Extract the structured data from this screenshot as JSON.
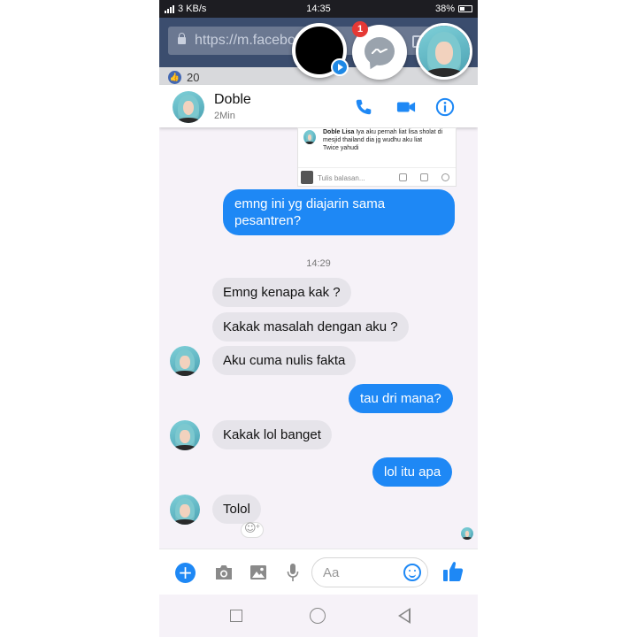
{
  "status_bar": {
    "network_speed": "3 KB/s",
    "time": "14:35",
    "battery": "38%"
  },
  "browser": {
    "url": "https://m.facebo",
    "likes": "20"
  },
  "chat_heads": {
    "badge_count": "1"
  },
  "chat_header": {
    "name": "Doble",
    "status": "2Min"
  },
  "shared_post": {
    "author": "Doble Lisa",
    "text": "Iya aku pernah liat lisa sholat di mesjid thailand dia jg wudhu aku liat",
    "text2": "Twice yahudi",
    "reply_placeholder": "Tulis balasan..."
  },
  "messages": [
    {
      "side": "out",
      "text": "emng ini yg diajarin sama pesantren?"
    },
    {
      "side": "in",
      "text": "Emng kenapa kak ?"
    },
    {
      "side": "in",
      "text": "Kakak masalah dengan aku ?"
    },
    {
      "side": "in",
      "text": "Aku cuma nulis fakta"
    },
    {
      "side": "out",
      "text": "tau dri mana?"
    },
    {
      "side": "in",
      "text": "Kakak lol banget"
    },
    {
      "side": "out",
      "text": "lol itu apa"
    },
    {
      "side": "in",
      "text": "Tolol"
    }
  ],
  "timestamp": "14:29",
  "composer": {
    "placeholder": "Aa"
  },
  "colors": {
    "accent": "#1e88f5",
    "incoming_bubble": "#e6e4ea",
    "background": "#f6f2f8",
    "badge": "#e53935"
  },
  "icons": [
    "phone-icon",
    "video-camera-icon",
    "info-icon",
    "plus-icon",
    "camera-icon",
    "image-icon",
    "microphone-icon",
    "emoji-icon",
    "thumbs-up-icon",
    "lock-icon",
    "messenger-icon"
  ]
}
